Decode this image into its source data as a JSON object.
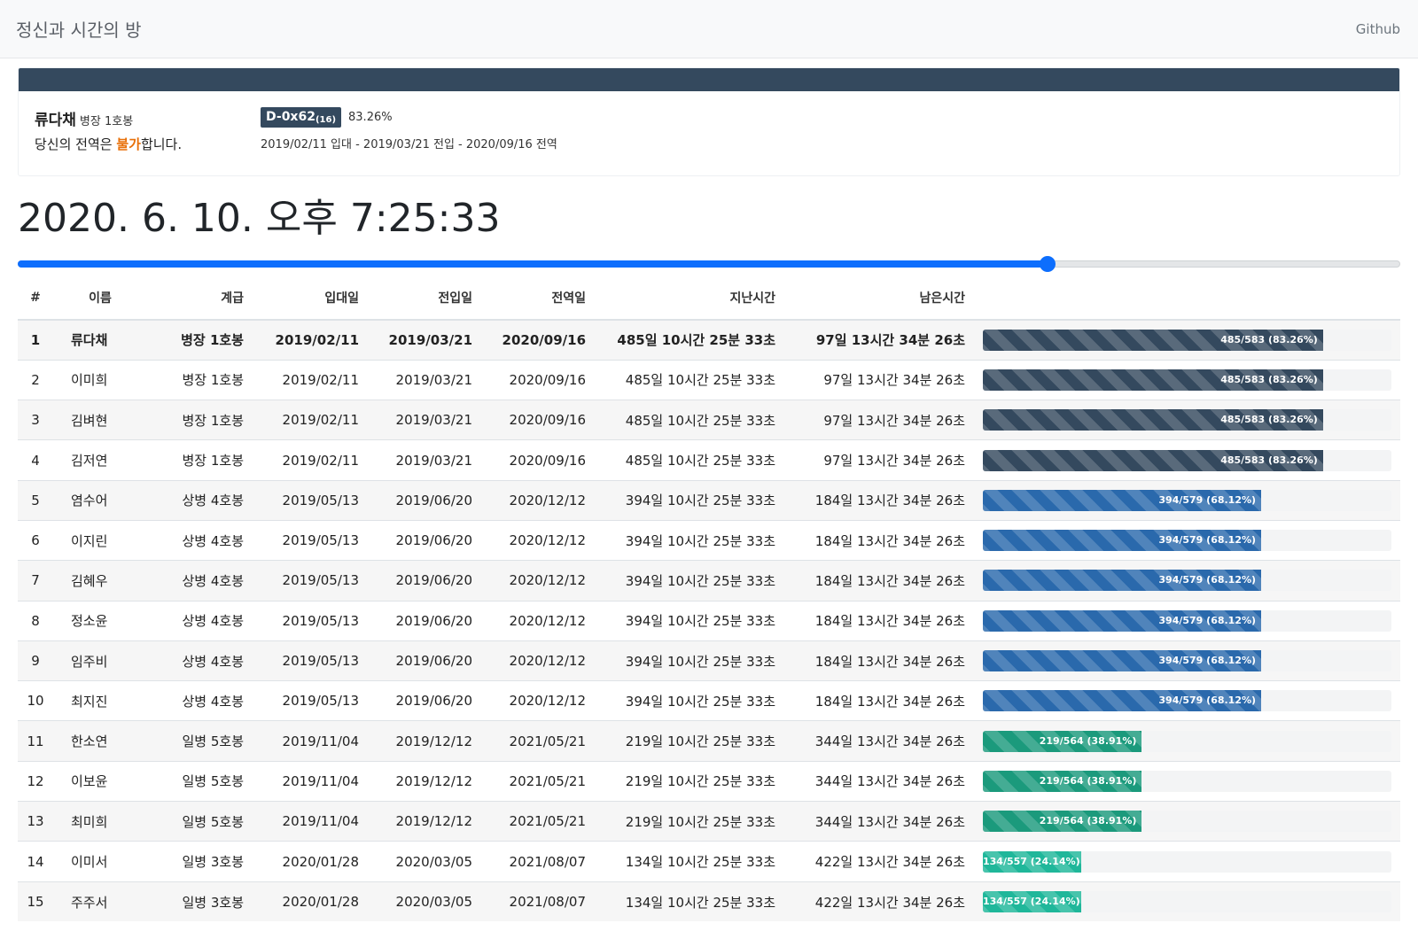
{
  "navbar": {
    "brand": "정신과 시간의 방",
    "link": "Github"
  },
  "profile": {
    "name": "류다채",
    "rank": "병장 1호봉",
    "message_prefix": "당신의 전역은 ",
    "message_highlight": "불가",
    "message_suffix": "합니다.",
    "dday_main": "D-0x62",
    "dday_sub": "(16)",
    "percent": "83.26%",
    "dates": "2019/02/11 입대 - 2019/03/21 전입 - 2020/09/16 전역",
    "header_color": "#34495e",
    "highlight_color": "#e8700a"
  },
  "clock": "2020. 6. 10. 오후 7:25:33",
  "slider": {
    "value_fraction": 0.745,
    "color": "#0d6efd"
  },
  "table": {
    "headers": [
      "#",
      "이름",
      "계급",
      "입대일",
      "전입일",
      "전역일",
      "지난시간",
      "남은시간",
      ""
    ],
    "bar_colors": {
      "병장": "#34495e",
      "상병": "#2a69ac",
      "일병": "#1b9a7c",
      "이병": "#1fb79a"
    },
    "rows": [
      {
        "num": "1",
        "name": "류다채",
        "rank": "병장 1호봉",
        "enlist": "2019/02/11",
        "transfer": "2019/03/21",
        "discharge": "2020/09/16",
        "elapsed": "485일 10시간 25분 33초",
        "remaining": "97일 13시간 34분 26초",
        "progress_label": "485/583 (83.26%)",
        "progress": 0.8326,
        "color": "#34495e",
        "bold": true
      },
      {
        "num": "2",
        "name": "이미희",
        "rank": "병장 1호봉",
        "enlist": "2019/02/11",
        "transfer": "2019/03/21",
        "discharge": "2020/09/16",
        "elapsed": "485일 10시간 25분 33초",
        "remaining": "97일 13시간 34분 26초",
        "progress_label": "485/583 (83.26%)",
        "progress": 0.8326,
        "color": "#34495e"
      },
      {
        "num": "3",
        "name": "김벼현",
        "rank": "병장 1호봉",
        "enlist": "2019/02/11",
        "transfer": "2019/03/21",
        "discharge": "2020/09/16",
        "elapsed": "485일 10시간 25분 33초",
        "remaining": "97일 13시간 34분 26초",
        "progress_label": "485/583 (83.26%)",
        "progress": 0.8326,
        "color": "#34495e"
      },
      {
        "num": "4",
        "name": "김저연",
        "rank": "병장 1호봉",
        "enlist": "2019/02/11",
        "transfer": "2019/03/21",
        "discharge": "2020/09/16",
        "elapsed": "485일 10시간 25분 33초",
        "remaining": "97일 13시간 34분 26초",
        "progress_label": "485/583 (83.26%)",
        "progress": 0.8326,
        "color": "#34495e"
      },
      {
        "num": "5",
        "name": "염수어",
        "rank": "상병 4호봉",
        "enlist": "2019/05/13",
        "transfer": "2019/06/20",
        "discharge": "2020/12/12",
        "elapsed": "394일 10시간 25분 33초",
        "remaining": "184일 13시간 34분 26초",
        "progress_label": "394/579 (68.12%)",
        "progress": 0.6812,
        "color": "#2a69ac"
      },
      {
        "num": "6",
        "name": "이지린",
        "rank": "상병 4호봉",
        "enlist": "2019/05/13",
        "transfer": "2019/06/20",
        "discharge": "2020/12/12",
        "elapsed": "394일 10시간 25분 33초",
        "remaining": "184일 13시간 34분 26초",
        "progress_label": "394/579 (68.12%)",
        "progress": 0.6812,
        "color": "#2a69ac"
      },
      {
        "num": "7",
        "name": "김혜우",
        "rank": "상병 4호봉",
        "enlist": "2019/05/13",
        "transfer": "2019/06/20",
        "discharge": "2020/12/12",
        "elapsed": "394일 10시간 25분 33초",
        "remaining": "184일 13시간 34분 26초",
        "progress_label": "394/579 (68.12%)",
        "progress": 0.6812,
        "color": "#2a69ac"
      },
      {
        "num": "8",
        "name": "정소윤",
        "rank": "상병 4호봉",
        "enlist": "2019/05/13",
        "transfer": "2019/06/20",
        "discharge": "2020/12/12",
        "elapsed": "394일 10시간 25분 33초",
        "remaining": "184일 13시간 34분 26초",
        "progress_label": "394/579 (68.12%)",
        "progress": 0.6812,
        "color": "#2a69ac"
      },
      {
        "num": "9",
        "name": "임주비",
        "rank": "상병 4호봉",
        "enlist": "2019/05/13",
        "transfer": "2019/06/20",
        "discharge": "2020/12/12",
        "elapsed": "394일 10시간 25분 33초",
        "remaining": "184일 13시간 34분 26초",
        "progress_label": "394/579 (68.12%)",
        "progress": 0.6812,
        "color": "#2a69ac"
      },
      {
        "num": "10",
        "name": "최지진",
        "rank": "상병 4호봉",
        "enlist": "2019/05/13",
        "transfer": "2019/06/20",
        "discharge": "2020/12/12",
        "elapsed": "394일 10시간 25분 33초",
        "remaining": "184일 13시간 34분 26초",
        "progress_label": "394/579 (68.12%)",
        "progress": 0.6812,
        "color": "#2a69ac"
      },
      {
        "num": "11",
        "name": "한소연",
        "rank": "일병 5호봉",
        "enlist": "2019/11/04",
        "transfer": "2019/12/12",
        "discharge": "2021/05/21",
        "elapsed": "219일 10시간 25분 33초",
        "remaining": "344일 13시간 34분 26초",
        "progress_label": "219/564 (38.91%)",
        "progress": 0.3891,
        "color": "#1b9a7c"
      },
      {
        "num": "12",
        "name": "이보윤",
        "rank": "일병 5호봉",
        "enlist": "2019/11/04",
        "transfer": "2019/12/12",
        "discharge": "2021/05/21",
        "elapsed": "219일 10시간 25분 33초",
        "remaining": "344일 13시간 34분 26초",
        "progress_label": "219/564 (38.91%)",
        "progress": 0.3891,
        "color": "#1b9a7c"
      },
      {
        "num": "13",
        "name": "최미희",
        "rank": "일병 5호봉",
        "enlist": "2019/11/04",
        "transfer": "2019/12/12",
        "discharge": "2021/05/21",
        "elapsed": "219일 10시간 25분 33초",
        "remaining": "344일 13시간 34분 26초",
        "progress_label": "219/564 (38.91%)",
        "progress": 0.3891,
        "color": "#1b9a7c"
      },
      {
        "num": "14",
        "name": "이미서",
        "rank": "일병 3호봉",
        "enlist": "2020/01/28",
        "transfer": "2020/03/05",
        "discharge": "2021/08/07",
        "elapsed": "134일 10시간 25분 33초",
        "remaining": "422일 13시간 34분 26초",
        "progress_label": "134/557 (24.14%)",
        "progress": 0.2414,
        "color": "#1fb79a"
      },
      {
        "num": "15",
        "name": "주주서",
        "rank": "일병 3호봉",
        "enlist": "2020/01/28",
        "transfer": "2020/03/05",
        "discharge": "2021/08/07",
        "elapsed": "134일 10시간 25분 33초",
        "remaining": "422일 13시간 34분 26초",
        "progress_label": "134/557 (24.14%)",
        "progress": 0.2414,
        "color": "#1fb79a"
      }
    ]
  }
}
